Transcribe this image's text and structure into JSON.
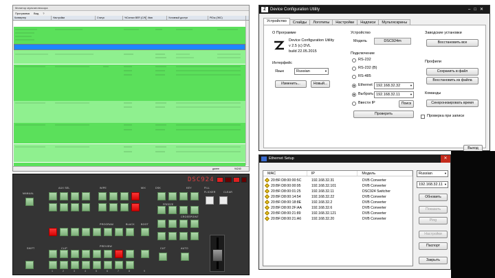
{
  "monitor": {
    "title": "Монитор мультиплексора",
    "menu": [
      "Программа",
      "Вид",
      "?"
    ],
    "columns": [
      "Конвертер",
      "Настройки",
      "Статус",
      "%Сигнал BER (C/N)",
      "Имя",
      "Условный доступ",
      "PIDы (ЭКС)"
    ],
    "status_right": "94240",
    "status_mid": "далее"
  },
  "hardware": {
    "brand": "DSC924",
    "label_manual": "MANUAL",
    "label_auto": "AUTO",
    "label_cut": "CUT",
    "label_crosspoint": "CROSSPOINT",
    "label_program": "PROGRAM",
    "label_preview": "PREVIEW",
    "label_black": "BLACK",
    "label_boot": "BOOT",
    "label_clear": "CLEAR",
    "label_flicker": "FLICKER",
    "label_freeze": "FREEZE",
    "label_shift": "SHIFT",
    "label_clip": "CLIP",
    "label_auxsel": "AUX SEL",
    "label_dsk": "DSK",
    "label_wipe": "WIPE",
    "label_mix": "MIX",
    "label_kcol": "KEY",
    "label_fill": "FILL",
    "label_numbers": [
      "1",
      "2",
      "3",
      "4",
      "5",
      "6",
      "7",
      "8",
      "9"
    ]
  },
  "config": {
    "window_title": "Device Configuration Utility",
    "tabs": [
      "Устройство",
      "Слайды",
      "Логотипы",
      "Настройки",
      "Надписи",
      "Мультискрины"
    ],
    "active_tab": "Устройство",
    "about_header": "О Программе",
    "about_name": "Device Configuration Utility",
    "about_version": "v 2.5  (c) DVL",
    "about_build": "build  22.05.2015",
    "interface_header": "Интерфейс",
    "lang_label": "Язык",
    "lang_value": "Russian",
    "btn_change": "Изменить...",
    "btn_new": "Новый...",
    "device_header": "Устройство",
    "model_label": "Модель",
    "model_value": "DSC924m",
    "connection_header": "Подключение",
    "radios": [
      "RS-232",
      "RS-232 (B)",
      "RS-485",
      "Ethernet",
      "Выбрать",
      "Ввести IP"
    ],
    "ethernet_ip": "192.168.32.32",
    "select_ip": "192.168.32.11",
    "btn_search": "Поиск",
    "btn_check": "Проверить",
    "factory_header": "Заводские установки",
    "btn_restore_all": "Восстановить все",
    "profiles_header": "Профили",
    "btn_save_file": "Сохранить в файл",
    "btn_restore_file": "Восстановить из файла",
    "commands_header": "Команды",
    "btn_sync_time": "Синхронизировать время",
    "check_on_write": "Проверка при записи",
    "btn_exit": "Выход"
  },
  "ethernet": {
    "title": "Ethernet Setup",
    "columns": [
      "MAC",
      "IP",
      "Модель"
    ],
    "rows": [
      {
        "mac": "20:BF:D8:00:00:5C",
        "ip": "192.168.32.31",
        "model": "DVB Converter"
      },
      {
        "mac": "20:BF:D8:00:00:95",
        "ip": "192.168.32.101",
        "model": "DVB Converter"
      },
      {
        "mac": "20:BF:D8:00:01:25",
        "ip": "192.168.32.11",
        "model": "DSC924 Switcher"
      },
      {
        "mac": "20:BF:D8:00:14:54",
        "ip": "192.168.32.22",
        "model": "DVB Converter"
      },
      {
        "mac": "20:BF:D8:00:18:8E",
        "ip": "192.168.32.2",
        "model": "DVB Converter"
      },
      {
        "mac": "20:BF:D8:00:2F:AA",
        "ip": "192.168.32.6",
        "model": "DVB Converter"
      },
      {
        "mac": "20:BF:D8:00:21:89",
        "ip": "192.168.32.121",
        "model": "DVB Converter"
      },
      {
        "mac": "20:BF:D8:00:21:A6",
        "ip": "192.168.32.20",
        "model": "DVB Converter"
      }
    ],
    "lang_value": "Russian",
    "ip_value": "192.168.32.11",
    "btn_refresh": "Обновить",
    "btn_show": "Показать",
    "btn_ping": "Ping",
    "btn_settings": "Настройки",
    "btn_passport": "Паспорт",
    "btn_close": "Закрыть"
  },
  "colors": {
    "accent_blue": "#1d86ff",
    "green_row": "#5be05b",
    "red_button": "#e00000",
    "panel_bg": "#343434"
  }
}
